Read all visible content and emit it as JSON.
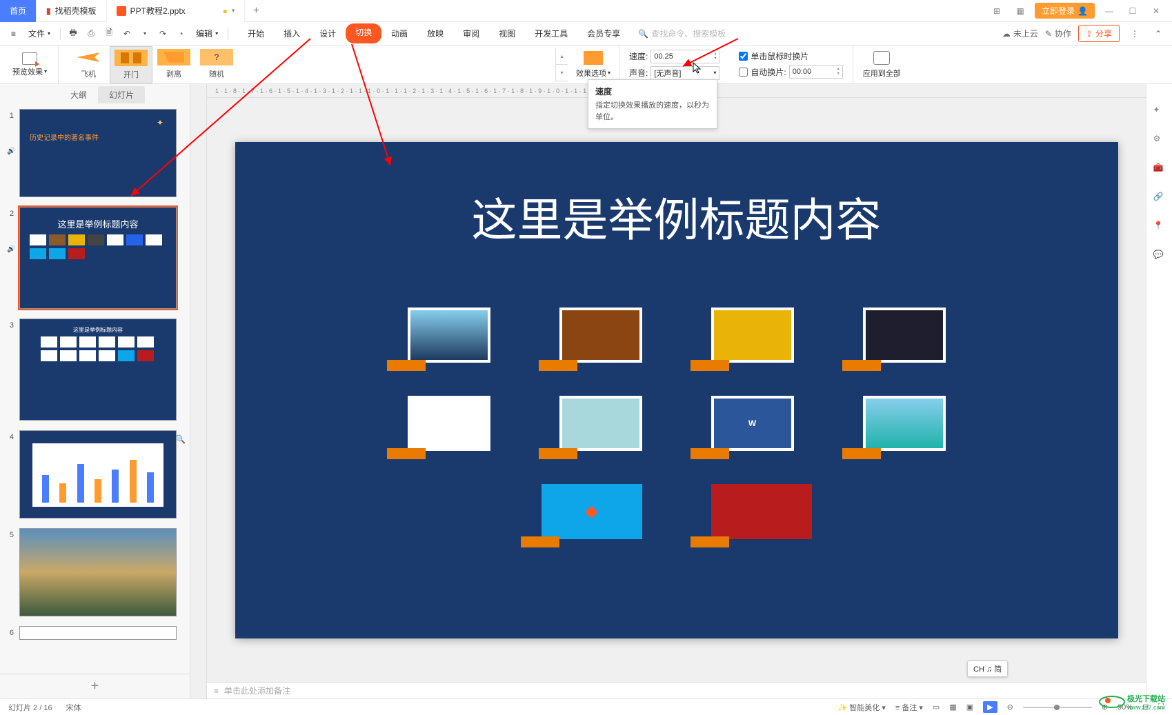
{
  "titlebar": {
    "home": "首页",
    "tab1": "找稻壳模板",
    "tab2": "PPT教程2.pptx",
    "login": "立即登录"
  },
  "menubar": {
    "file": "文件",
    "edit": "编辑",
    "tabs": [
      "开始",
      "插入",
      "设计",
      "切换",
      "动画",
      "放映",
      "审阅",
      "视图",
      "开发工具",
      "会员专享"
    ],
    "search_placeholder": "查找命令、搜索模板",
    "cloud": "未上云",
    "collab": "协作",
    "share": "分享"
  },
  "ribbon": {
    "preview": "预览效果",
    "trans": [
      {
        "label": "飞机"
      },
      {
        "label": "开门"
      },
      {
        "label": "剥离"
      },
      {
        "label": "随机"
      }
    ],
    "effect_opts": "效果选项",
    "speed_label": "速度:",
    "speed_value": "00.25",
    "sound_label": "声音:",
    "sound_value": "[无声音]",
    "click_label": "单击鼠标时换片",
    "auto_label": "自动换片:",
    "auto_value": "00:00",
    "apply_all": "应用到全部"
  },
  "tooltip": {
    "title": "速度",
    "desc": "指定切换效果播放的速度，以秒为单位。"
  },
  "side": {
    "outline": "大纲",
    "slides": "幻灯片",
    "t1_text1": "历史记录中的著名事件",
    "t2_title": "这里是举例标题内容",
    "t3_title": "这里是举例标题内容"
  },
  "slide": {
    "title": "这里是举例标题内容"
  },
  "notes": "单击此处添加备注",
  "status": {
    "page": "幻灯片 2 / 16",
    "font": "宋体",
    "beautify": "智能美化",
    "notes": "备注",
    "zoom": "90%"
  },
  "ime": "CH ♫ 简",
  "watermark": {
    "name": "极光下载站",
    "url": "www.xz7.com"
  }
}
